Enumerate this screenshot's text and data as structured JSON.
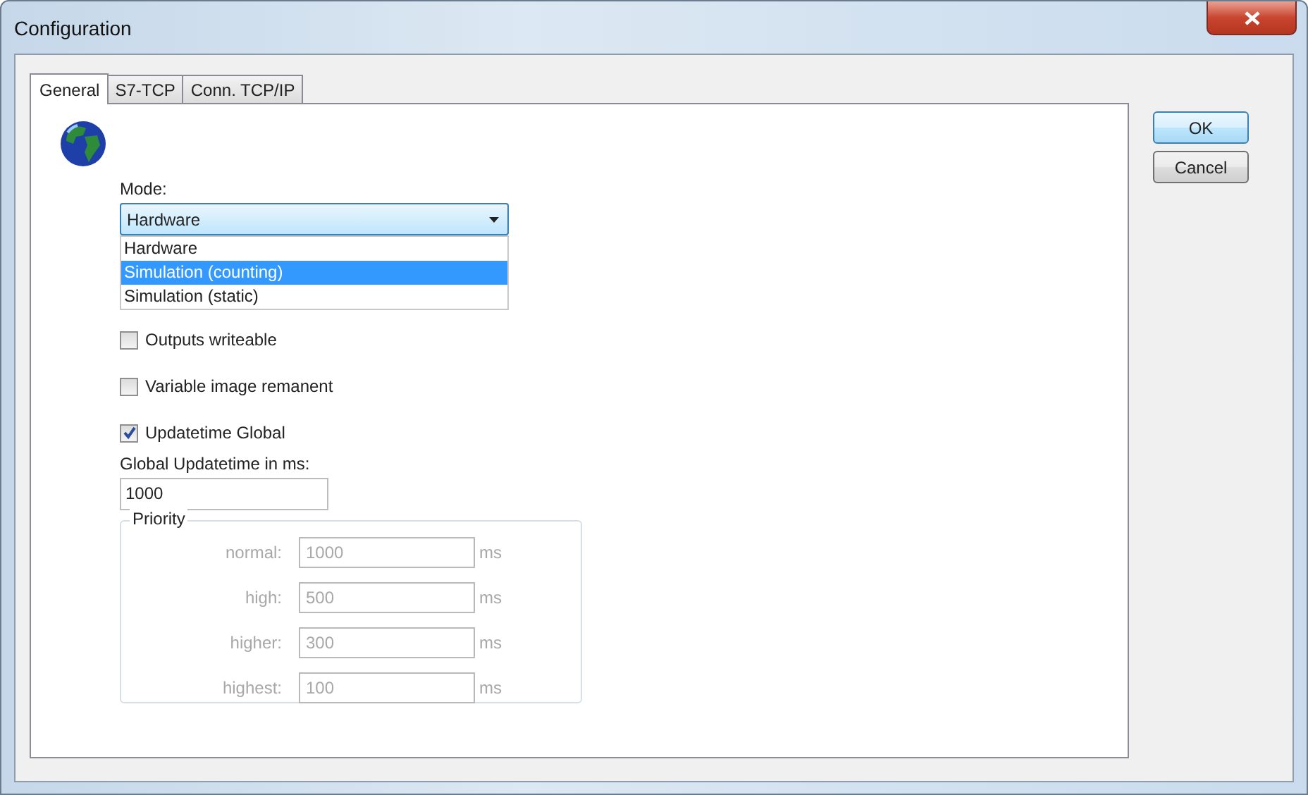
{
  "window": {
    "title": "Configuration"
  },
  "tabs": [
    {
      "label": "General",
      "selected": true
    },
    {
      "label": "S7-TCP",
      "selected": false
    },
    {
      "label": "Conn. TCP/IP",
      "selected": false
    }
  ],
  "mode": {
    "label": "Mode:",
    "value": "Hardware",
    "expanded": true,
    "options": [
      {
        "label": "Hardware",
        "highlighted": false
      },
      {
        "label": "Simulation (counting)",
        "highlighted": true
      },
      {
        "label": "Simulation (static)",
        "highlighted": false
      }
    ]
  },
  "checkboxes": [
    {
      "label": "Outputs writeable",
      "checked": false
    },
    {
      "label": "Variable image remanent",
      "checked": false
    },
    {
      "label": "Updatetime Global",
      "checked": true
    }
  ],
  "update_time": {
    "label": "Global Updatetime in ms:",
    "value": "1000"
  },
  "priority": {
    "title": "Priority",
    "disabled": true,
    "rows": [
      {
        "label": "normal:",
        "value": "1000",
        "unit": "ms"
      },
      {
        "label": "high:",
        "value": "500",
        "unit": "ms"
      },
      {
        "label": "higher:",
        "value": "300",
        "unit": "ms"
      },
      {
        "label": "highest:",
        "value": "100",
        "unit": "ms"
      }
    ]
  },
  "buttons": [
    {
      "label": "OK",
      "default": true
    },
    {
      "label": "Cancel",
      "default": false
    }
  ]
}
